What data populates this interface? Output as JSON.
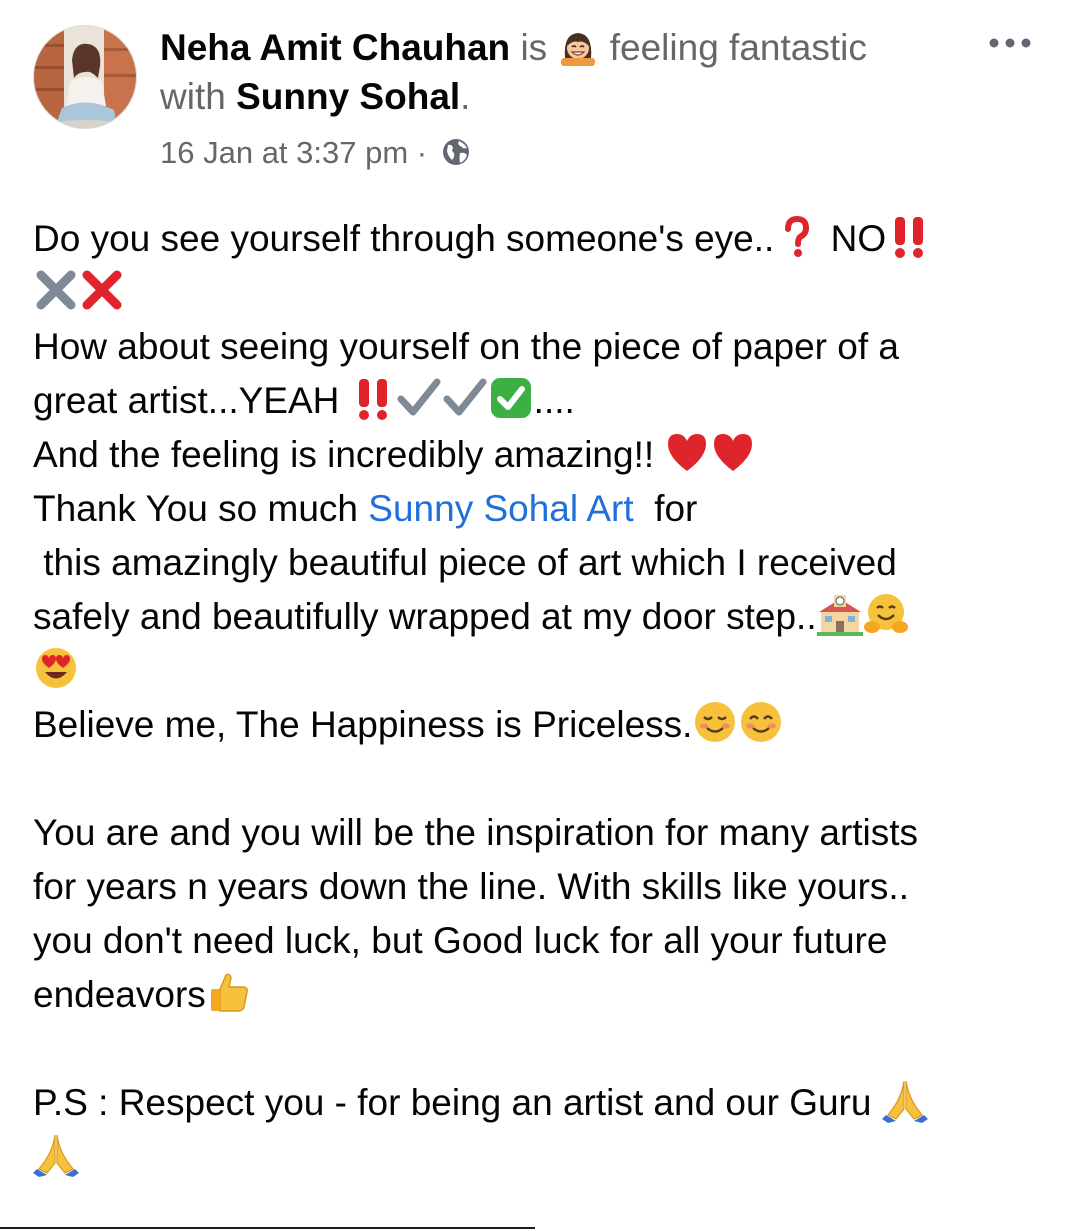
{
  "post": {
    "author": "Neha Amit Chauhan",
    "is_word": "is",
    "feeling_text": "feeling fantastic",
    "with_word": "with",
    "tagged": "Sunny Sohal",
    "period": ".",
    "timestamp": "16 Jan at 3:37 pm",
    "separator": "·",
    "privacy_icon": "globe-icon",
    "more_icon": "more-horizontal-icon"
  },
  "body": {
    "l1_text": "Do you see yourself through someone's eye..",
    "l1_no": "NO",
    "l3_text": "How about seeing yourself on the piece of paper of a",
    "l4_text": "great artist...YEAH",
    "l4_dots": "....",
    "l5_text": "And the feeling is incredibly amazing!!",
    "l6_pre": "Thank You so much",
    "l6_mention": "Sunny Sohal Art",
    "l6_post": "for",
    "l7_text": "this amazingly beautiful piece of art which I received",
    "l8_text": "safely and beautifully wrapped at my door step..",
    "l10_text": "Believe me, The Happiness is Priceless.",
    "l12_text": "You are and you will be the inspiration for many artists",
    "l13_text": "for years n years down the line. With skills like yours..",
    "l14_text": "you don't need luck,  but Good luck for all your future",
    "l15_text": "endeavors",
    "l17_text": "P.S : Respect you - for being an artist and our Guru"
  },
  "colors": {
    "text": "#050505",
    "secondary": "#65676b",
    "link": "#216fdb",
    "red": "#e0242b",
    "green": "#3cb043",
    "gray_check": "#7f8a96",
    "yellow": "#f7c23b"
  }
}
